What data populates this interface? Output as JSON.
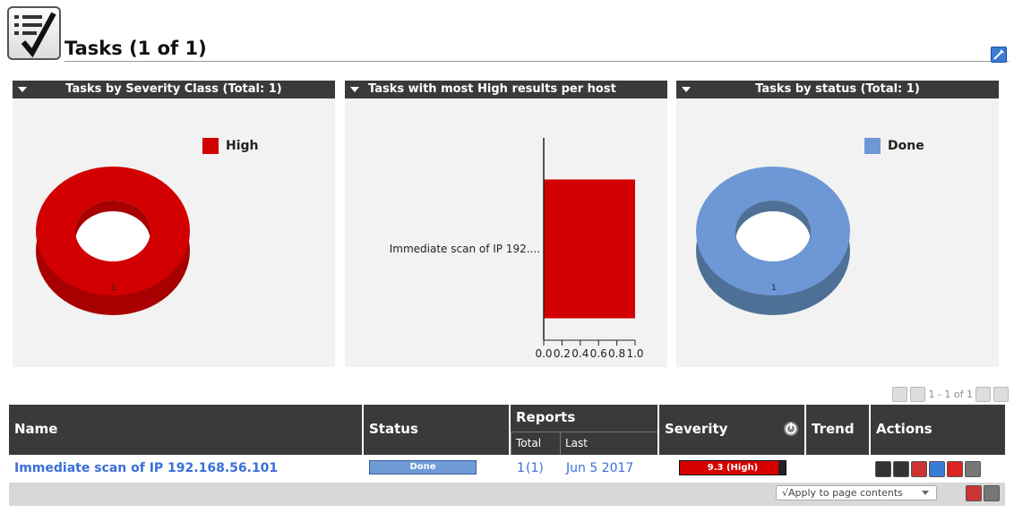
{
  "header": {
    "title": "Tasks (1 of 1)"
  },
  "panels": [
    {
      "title": "Tasks by Severity Class (Total: 1)",
      "legend": "High",
      "color": "#d20000",
      "value": "1"
    },
    {
      "title": "Tasks with most High results per host"
    },
    {
      "title": "Tasks by status (Total: 1)",
      "legend": "Done",
      "color": "#6e97d6",
      "value": "1"
    }
  ],
  "chart_data": [
    {
      "type": "pie",
      "title": "Tasks by Severity Class (Total: 1)",
      "labels": [
        "High"
      ],
      "values": [
        1
      ],
      "colors": [
        "#d20000"
      ],
      "legend_position": "top-right"
    },
    {
      "type": "bar",
      "title": "Tasks with most High results per host",
      "orientation": "horizontal",
      "categories": [
        "Immediate scan of IP 192...."
      ],
      "values": [
        1.0
      ],
      "xlim": [
        0.0,
        1.0
      ],
      "tick_labels": [
        "0.0",
        "0.2",
        "0.4",
        "0.6",
        "0.8",
        "1.0"
      ],
      "color": "#d20000"
    },
    {
      "type": "pie",
      "title": "Tasks by status (Total: 1)",
      "labels": [
        "Done"
      ],
      "values": [
        1
      ],
      "colors": [
        "#6e97d6"
      ],
      "legend_position": "top-right"
    }
  ],
  "pager": {
    "text": "1 - 1 of 1"
  },
  "table": {
    "headers": {
      "name": "Name",
      "status": "Status",
      "reports": "Reports",
      "total": "Total",
      "last": "Last",
      "severity": "Severity",
      "trend": "Trend",
      "actions": "Actions"
    },
    "row": {
      "name": "Immediate scan of IP 192.168.56.101",
      "status": "Done",
      "reports_total": "1",
      "reports_total_paren": "(1)",
      "last": "Jun 5 2017",
      "severity": "9.3 (High)",
      "severity_fraction": 0.93
    },
    "apply_label": "√Apply to page contents"
  }
}
